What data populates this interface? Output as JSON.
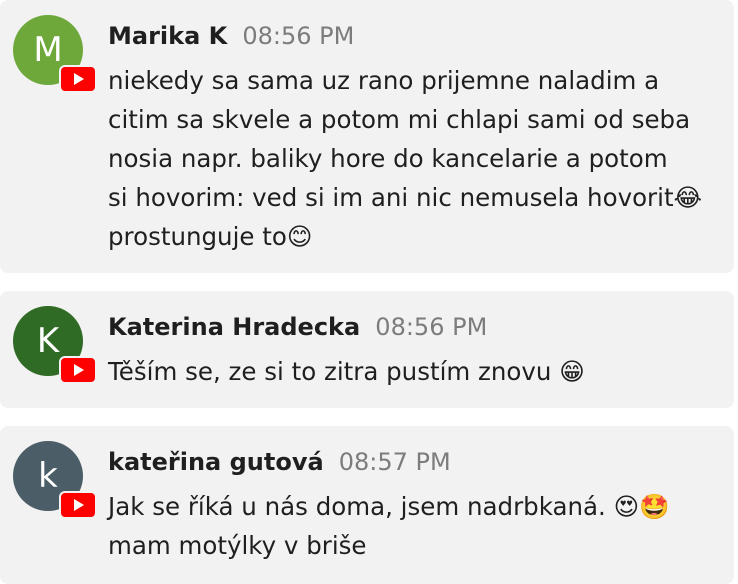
{
  "colors": {
    "card_bg": "#f2f2f2",
    "text": "#1f1f1f",
    "timestamp": "#7c7c7c",
    "youtube_red": "#ff0000"
  },
  "comments": [
    {
      "avatar_letter": "M",
      "avatar_color": "#6ea83a",
      "badge_icon": "youtube-icon",
      "author": "Marika K",
      "time": "08:56 PM",
      "text": "niekedy sa sama uz rano prijemne naladim a\ncitim sa skvele a potom mi chlapi sami od seba\nnosia napr. baliky hore do kancelarie a potom\nsi hovorim: ved si im ani nic nemusela hovorit😂\nprostunguje to😊"
    },
    {
      "avatar_letter": "K",
      "avatar_color": "#2f6b24",
      "badge_icon": "youtube-icon",
      "author": "Katerina Hradecka",
      "time": "08:56 PM",
      "text": "Těším se, ze si to zitra pustím znovu 😁"
    },
    {
      "avatar_letter": "k",
      "avatar_color": "#4b5e68",
      "badge_icon": "youtube-icon",
      "author": "kateřina gutová",
      "time": "08:57 PM",
      "text": "Jak se říká u nás doma, jsem nadrbkaná. 😍🤩\nmam motýlky v briše"
    }
  ]
}
